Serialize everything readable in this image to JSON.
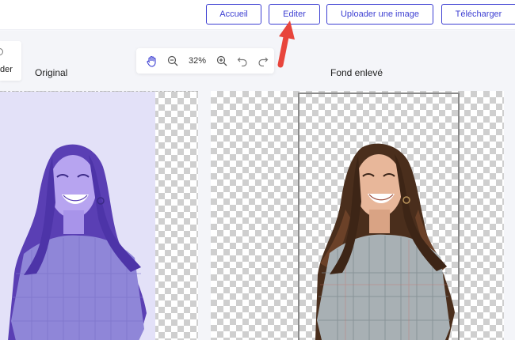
{
  "toolbar": {
    "accueil": "Accueil",
    "editer": "Editer",
    "upload": "Uploader une image",
    "download": "Télécharger"
  },
  "sidebar": {
    "partial_label": "der"
  },
  "zoom": {
    "level": "32%"
  },
  "panels": {
    "original_label": "Original",
    "result_label": "Fond enlevé"
  },
  "colors": {
    "accent": "#3d3fd2",
    "arrow": "#e8453c",
    "original_tint": "#7b6ee0"
  },
  "icons": [
    "hand-icon",
    "zoom-out-icon",
    "zoom-in-icon",
    "undo-icon",
    "redo-icon",
    "pointer-arrow"
  ]
}
